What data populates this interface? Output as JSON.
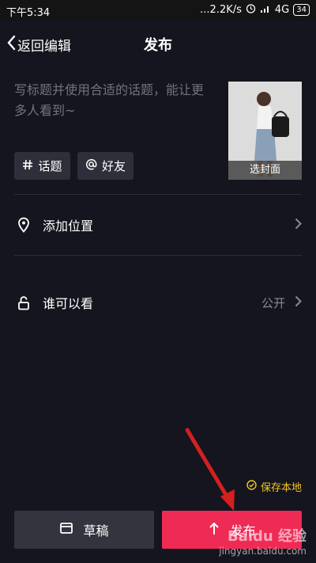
{
  "status_bar": {
    "time": "下午5:34",
    "net_speed": "...2.2K/s",
    "network": "4G",
    "battery": "34"
  },
  "header": {
    "back_label": "返回编辑",
    "title": "发布"
  },
  "caption": {
    "placeholder": "写标题并使用合适的话题，能让更多人看到~"
  },
  "cover": {
    "label": "选封面"
  },
  "chips": {
    "topic": "话题",
    "friend": "好友"
  },
  "rows": {
    "location": "添加位置",
    "visibility": "谁可以看",
    "visibility_value": "公开"
  },
  "save_local": "保存本地",
  "buttons": {
    "draft": "草稿",
    "publish": "发布"
  },
  "watermark": {
    "main": "Baidu 经验",
    "sub": "jingyan.baidu.com"
  },
  "colors": {
    "background": "#15151f",
    "publish_button": "#ef2a55",
    "draft_button": "#34343f",
    "save_local": "#f5c623",
    "annotation_arrow": "#d42020"
  }
}
